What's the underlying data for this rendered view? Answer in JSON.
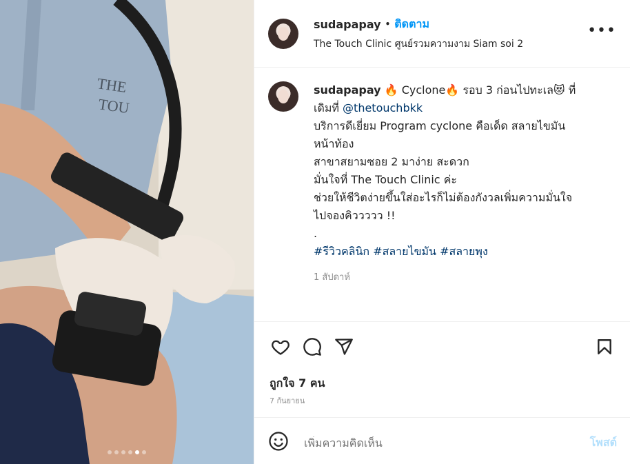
{
  "header": {
    "username": "sudapapay",
    "separator": "•",
    "follow_label": "ติดตาม",
    "location": "The Touch Clinic ศูนย์รวมความงาม Siam soi 2",
    "more_label": "•••"
  },
  "caption": {
    "username": "sudapapay",
    "lines": [
      "🔥 Cyclone🔥  รอบ 3 ก่อนไปทะเล😻 ที่",
      "เดิมที่ ",
      "บริการดีเยี่ยม Program cyclone คือเด็ด สลายไขมัน",
      "หน้าท้อง",
      "สาขาสยามซอย 2 มาง่าย สะดวก",
      "มั่นใจที่ The Touch Clinic ค่ะ",
      "ช่วยให้ชีวิตง่ายขึ้นใส่อะไรก็ไม่ต้องกังวลเพิ่มความมั่นใจ",
      "ไปจองคิววววว !!",
      "."
    ],
    "mention": "@thetouchbkk",
    "hashtags": "#รีวิวคลินิก #สลายไขมัน #สลายพุง",
    "time_ago": "1 สัปดาห์"
  },
  "actions": {
    "like_icon": "heart-icon",
    "comment_icon": "comment-icon",
    "share_icon": "paper-plane-icon",
    "save_icon": "bookmark-icon"
  },
  "likes_text": "ถูกใจ 7 คน",
  "date_text": "7 กันยายน",
  "comment": {
    "emoji_icon": "smiley-icon",
    "placeholder": "เพิ่มความคิดเห็น",
    "post_label": "โพสต์"
  },
  "carousel": {
    "total": 6,
    "active_index": 4
  },
  "colors": {
    "accent": "#0095f6",
    "link": "#00376b",
    "muted": "#8e8e8e",
    "post_disabled": "#b2dffc"
  }
}
